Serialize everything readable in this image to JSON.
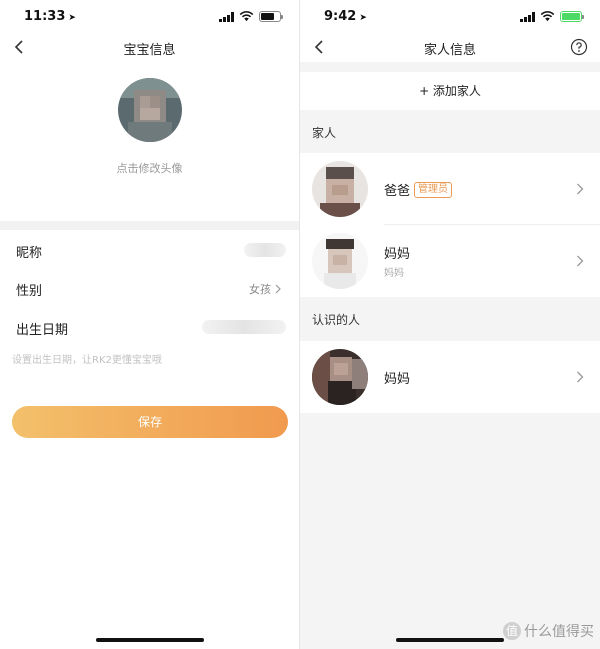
{
  "left_screen": {
    "status_bar": {
      "time": "11:33"
    },
    "nav": {
      "title": "宝宝信息"
    },
    "avatar_hint": "点击修改头像",
    "fields": {
      "nickname_label": "昵称",
      "gender_label": "性别",
      "gender_value": "女孩",
      "birthday_label": "出生日期"
    },
    "birthday_hint": "设置出生日期，让RK2更懂宝宝哦",
    "save_label": "保存"
  },
  "right_screen": {
    "status_bar": {
      "time": "9:42"
    },
    "nav": {
      "title": "家人信息"
    },
    "add_member_label": "+ 添加家人",
    "family_section": {
      "title": "家人",
      "members": [
        {
          "name": "爸爸",
          "badge": "管理员",
          "subtitle": ""
        },
        {
          "name": "妈妈",
          "badge": "",
          "subtitle": "妈妈"
        }
      ]
    },
    "known_section": {
      "title": "认识的人",
      "members": [
        {
          "name": "妈妈"
        }
      ]
    }
  },
  "watermark": {
    "text": "什么值得买",
    "logo": "值"
  },
  "colors": {
    "accent_start": "#f3c06b",
    "accent_end": "#f19a4e",
    "badge": "#e99a53",
    "battery": "#4cd964"
  },
  "icons": [
    "location-arrow-icon",
    "signal-icon",
    "wifi-icon",
    "battery-icon",
    "back-chevron-icon",
    "chevron-right-icon",
    "help-circle-icon"
  ]
}
